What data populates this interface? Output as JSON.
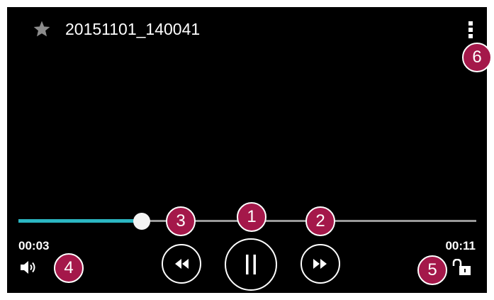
{
  "player": {
    "file_title": "20151101_140041",
    "time_elapsed": "00:03",
    "time_total": "00:11",
    "progress_fraction": 0.27
  },
  "icons": {
    "favorite": "star-icon",
    "menu": "overflow-menu-icon",
    "volume": "volume-icon",
    "lock": "unlock-icon",
    "rewind": "rewind-icon",
    "pause": "pause-icon",
    "fast_forward": "fast-forward-icon"
  },
  "callouts": [
    "1",
    "2",
    "3",
    "4",
    "5",
    "6"
  ],
  "colors": {
    "background": "#000000",
    "progress": "#2bb6c2",
    "track": "#9a9a9a",
    "callout": "#a4184a",
    "icon": "#ffffff",
    "star": "#8c8c8c"
  }
}
